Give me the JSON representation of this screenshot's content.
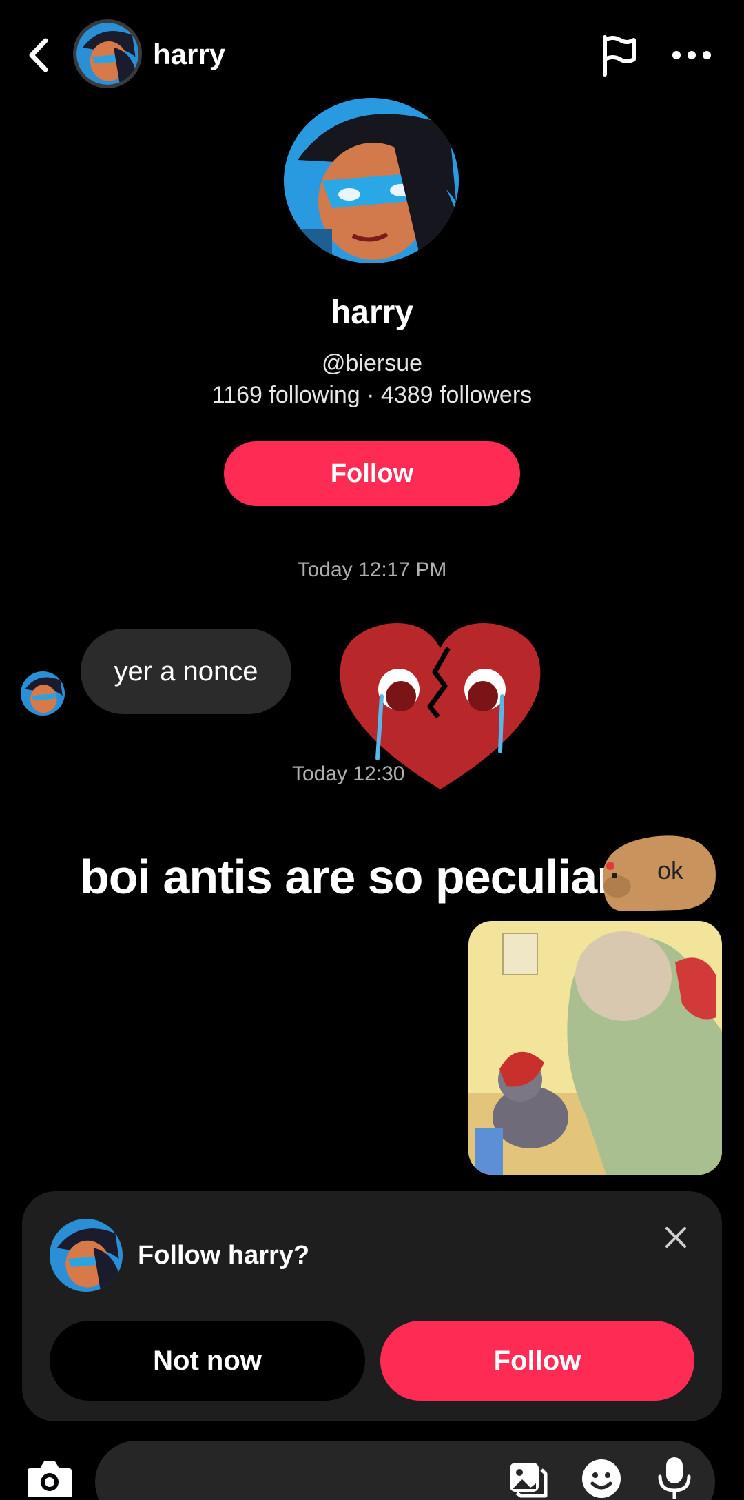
{
  "header": {
    "name": "harry",
    "icons": [
      "back-arrow",
      "avatar",
      "flag",
      "more-dots"
    ]
  },
  "profile": {
    "name": "harry",
    "handle": "@biersue",
    "stats": "1169 following · 4389 followers",
    "follow_label": "Follow"
  },
  "messages": {
    "timestamp_1": "Today 12:17 PM",
    "bubble_text": "yer a nonce",
    "timestamp_2": "Today 12:30",
    "caption": "boi antis are so peculiar",
    "sticker_text": "ok"
  },
  "follow_prompt": {
    "title": "Follow harry?",
    "not_now_label": "Not now",
    "follow_label": "Follow"
  },
  "composer": {
    "icons": [
      "camera",
      "gallery",
      "emoji",
      "microphone"
    ]
  },
  "colors": {
    "accent": "#fe2c55",
    "background": "#000000",
    "bubble": "#2b2b2b",
    "card": "#1e1e1e"
  }
}
